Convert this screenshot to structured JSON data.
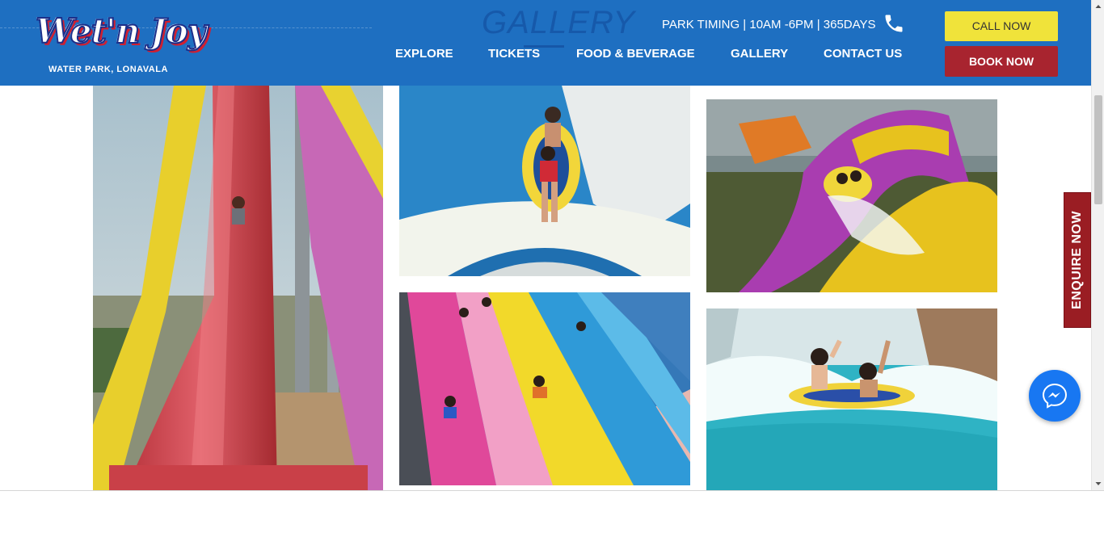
{
  "brand": {
    "logo_text": "Wet'n Joy",
    "logo_subtitle": "WATER PARK, LONAVALA"
  },
  "header": {
    "section_title": "GALLERY",
    "park_timing": "PARK TIMING | 10AM -6PM | 365DAYS",
    "nav": {
      "explore": "EXPLORE",
      "tickets": "TICKETS",
      "food": "FOOD & BEVERAGE",
      "gallery": "GALLERY",
      "contact": "CONTACT US"
    },
    "call_now": "CALL NOW",
    "book_now": "BOOK NOW"
  },
  "enquire": {
    "label": "ENQUIRE NOW"
  },
  "colors": {
    "header_bg": "#1e6fc1",
    "call_button": "#f0e33a",
    "book_button": "#a8242f",
    "enquire_tab": "#9a1d23",
    "messenger": "#1877f2"
  },
  "icons": [
    "phone-icon",
    "messenger-icon",
    "scroll-up-icon",
    "scroll-down-icon"
  ]
}
